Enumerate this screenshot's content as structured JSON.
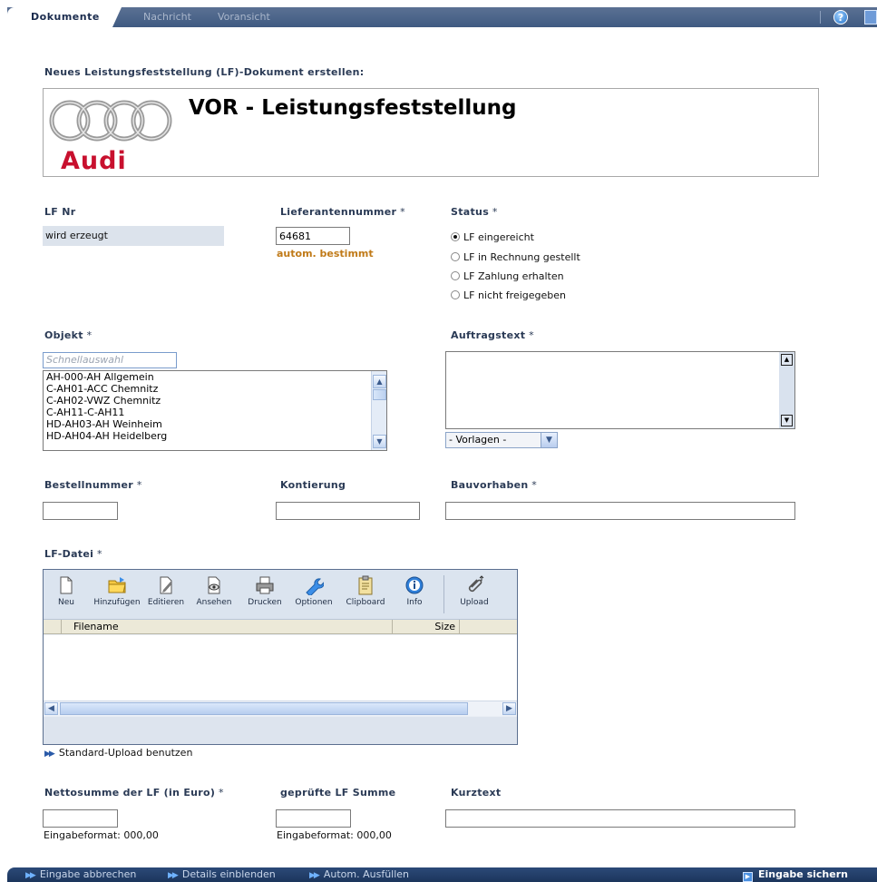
{
  "tabs": {
    "active": "Dokumente",
    "nachricht": "Nachricht",
    "voransicht": "Voransicht",
    "help": "?"
  },
  "section_title": "Neues Leistungsfeststellung (LF)-Dokument erstellen:",
  "document": {
    "title": "VOR - Leistungsfeststellung",
    "logo_text": "Audi"
  },
  "lfnr": {
    "label": "LF Nr",
    "value": "wird erzeugt"
  },
  "lieferant": {
    "label": "Lieferantennummer",
    "required": " *",
    "value": "64681",
    "note": "autom. bestimmt"
  },
  "status": {
    "label": "Status",
    "required": " *",
    "options": [
      "LF eingereicht",
      "LF in Rechnung gestellt",
      "LF Zahlung erhalten",
      "LF nicht freigegeben"
    ],
    "selected_index": 0
  },
  "objekt": {
    "label": "Objekt",
    "required": " *",
    "quick_placeholder": "Schnellauswahl",
    "items": [
      "AH-000-AH Allgemein",
      "C-AH01-ACC Chemnitz",
      "C-AH02-VWZ Chemnitz",
      "C-AH11-C-AH11",
      "HD-AH03-AH Weinheim",
      "HD-AH04-AH Heidelberg"
    ]
  },
  "auftragstext": {
    "label": "Auftragstext",
    "required": " *",
    "value": "",
    "vorlagen": "- Vorlagen -"
  },
  "bestellnummer": {
    "label": "Bestellnummer",
    "required": " *",
    "value": ""
  },
  "kontierung": {
    "label": "Kontierung",
    "value": ""
  },
  "bauvorhaben": {
    "label": "Bauvorhaben",
    "required": " *",
    "value": ""
  },
  "lfdatei": {
    "label": "LF-Datei",
    "required": " *",
    "toolbar": [
      "Neu",
      "Hinzufügen",
      "Editieren",
      "Ansehen",
      "Drucken",
      "Optionen",
      "Clipboard",
      "Info",
      "Upload"
    ],
    "columns": {
      "filename": "Filename",
      "size": "Size"
    },
    "standard_upload": "Standard-Upload benutzen"
  },
  "netto": {
    "label": "Nettosumme der LF (in Euro)",
    "required": " *",
    "value": "",
    "hint": "Eingabeformat: 000,00"
  },
  "geprueft": {
    "label": "geprüfte LF Summe",
    "value": "",
    "hint": "Eingabeformat: 000,00"
  },
  "kurztext": {
    "label": "Kurztext",
    "value": ""
  },
  "bottom": {
    "cancel": "Eingabe abbrechen",
    "details": "Details einblenden",
    "autofill": "Autom. Ausfüllen",
    "save": "Eingabe sichern"
  }
}
